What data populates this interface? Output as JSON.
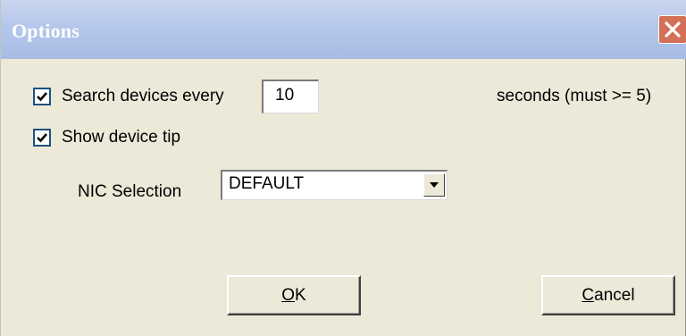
{
  "window": {
    "title": "Options"
  },
  "options": {
    "search_checkbox_checked": true,
    "search_label": "Search devices every",
    "search_interval_value": "10",
    "search_interval_hint": "seconds (must >= 5)",
    "tip_checkbox_checked": true,
    "tip_label": "Show device tip",
    "nic_label": "NIC Selection",
    "nic_selected": "DEFAULT"
  },
  "buttons": {
    "ok_mnemonic": "O",
    "ok_rest": "K",
    "cancel_mnemonic": "C",
    "cancel_rest": "ancel"
  },
  "colors": {
    "title_gradient_top": "#c9d6ef",
    "title_gradient_bottom": "#a8bbe3",
    "close_button": "#d47058",
    "dialog_background": "#ece9d8"
  },
  "icons": {
    "close": "close-icon",
    "check": "checkmark-icon",
    "dropdown": "chevron-down-icon"
  }
}
